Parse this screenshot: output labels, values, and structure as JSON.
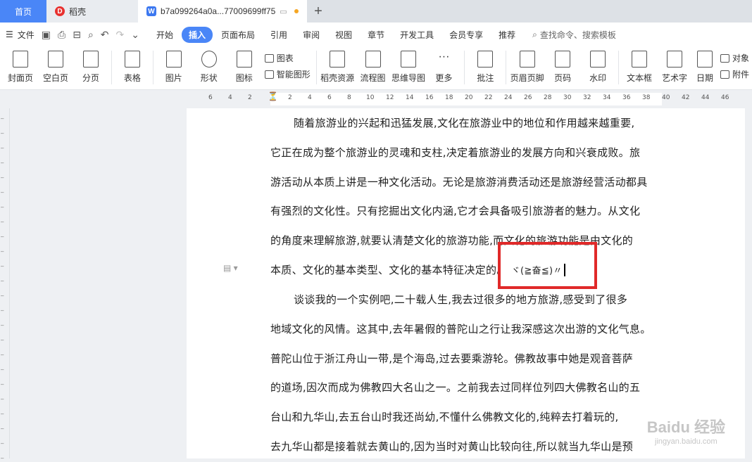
{
  "tabs": {
    "home": "首页",
    "docer": "稻壳",
    "document": "b7a099264a0a...77009699ff75"
  },
  "menu": {
    "file": "文件",
    "items": [
      "开始",
      "插入",
      "页面布局",
      "引用",
      "审阅",
      "视图",
      "章节",
      "开发工具",
      "会员专享",
      "推荐"
    ],
    "active": "插入",
    "search_placeholder": "查找命令、搜索模板"
  },
  "ribbon": {
    "cover": "封面页",
    "blank": "空白页",
    "break": "分页",
    "table": "表格",
    "picture": "图片",
    "shape": "形状",
    "icon": "图标",
    "chart": "图表",
    "smartart": "智能图形",
    "docer_res": "稻壳资源",
    "flowchart": "流程图",
    "mindmap": "思维导图",
    "more": "更多",
    "comment": "批注",
    "header_footer": "页眉页脚",
    "page_num": "页码",
    "watermark": "水印",
    "textbox": "文本框",
    "wordart": "艺术字",
    "date": "日期",
    "object": "对象",
    "attach": "附件"
  },
  "ruler": [
    "6",
    "4",
    "2",
    "2",
    "4",
    "6",
    "8",
    "10",
    "12",
    "14",
    "16",
    "18",
    "20",
    "22",
    "24",
    "26",
    "28",
    "30",
    "32",
    "34",
    "36",
    "38",
    "40",
    "42",
    "44",
    "46"
  ],
  "document": {
    "para1": [
      "随着旅游业的兴起和迅猛发展,文化在旅游业中的地位和作用越来越重要,",
      "它正在成为整个旅游业的灵魂和支柱,决定着旅游业的发展方向和兴衰成败。旅",
      "游活动从本质上讲是一种文化活动。无论是旅游消费活动还是旅游经营活动都具",
      "有强烈的文化性。只有挖掘出文化内涵,它才会具备吸引旅游者的魅力。从文化",
      "的角度来理解旅游,就要认清楚文化的旅游功能,而文化的旅游功能是由文化的",
      "本质、文化的基本类型、文化的基本特征决定的。"
    ],
    "inserted_symbol": "ヾ(≧奋≦)〃",
    "para2": [
      "谈谈我的一个实例吧,二十载人生,我去过很多的地方旅游,感受到了很多",
      "地域文化的风情。这其中,去年暑假的普陀山之行让我深感这次出游的文化气息。",
      "普陀山位于浙江舟山一带,是个海岛,过去要乘游轮。佛教故事中她是观音菩萨",
      "的道场,因次而成为佛教四大名山之一。之前我去过同样位列四大佛教名山的五",
      "台山和九华山,去五台山时我还尚幼,不懂什么佛教文化的,纯粹去打着玩的,",
      "去九华山都是接着就去黄山的,因为当时对黄山比较向往,所以就当九华山是预"
    ]
  },
  "watermark": {
    "brand": "Baidu 经验",
    "url": "jingyan.baidu.com"
  },
  "colors": {
    "accent": "#4a86f7",
    "highlight": "#e02929"
  }
}
